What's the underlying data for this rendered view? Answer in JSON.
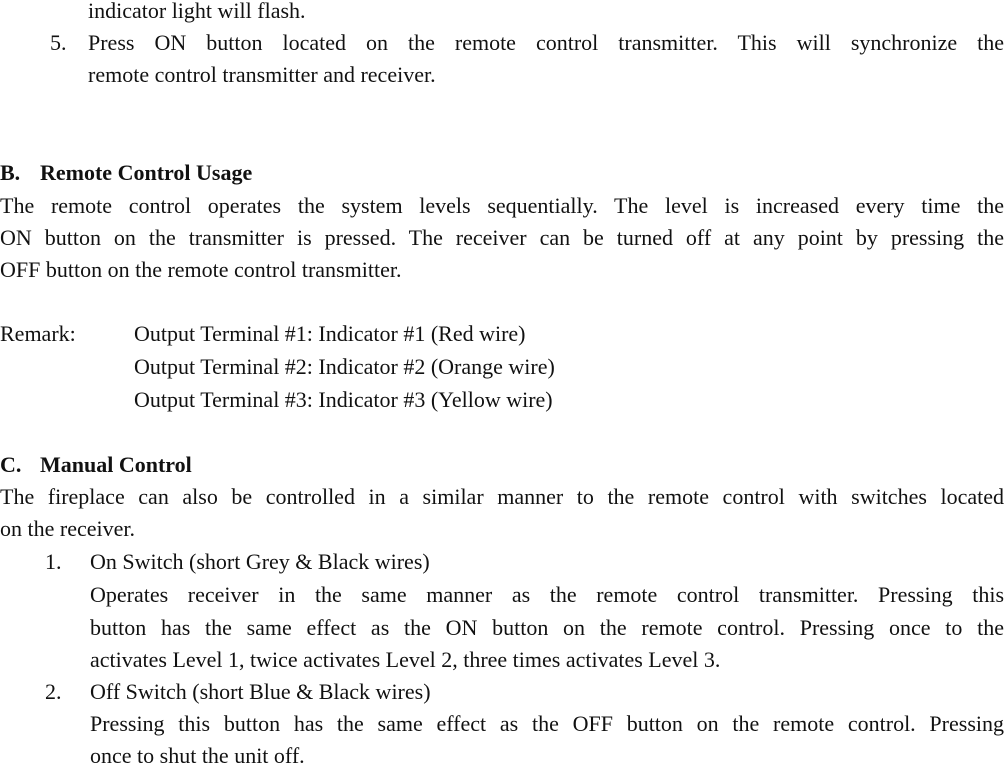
{
  "continuation": {
    "line1": "indicator light will flash."
  },
  "step5": {
    "number": "5.",
    "line1": "Press ON button located on the remote control transmitter. This will synchronize the",
    "line2": "remote control transmitter and receiver."
  },
  "section_b": {
    "letter": "B.",
    "title": "Remote Control Usage",
    "para_lines": [
      "The remote control operates the system levels sequentially. The level is increased every time the",
      "ON button on the transmitter is pressed. The receiver can be turned off at any point by pressing the",
      "OFF button on the remote control transmitter."
    ],
    "remark_label": "Remark:",
    "remarks": [
      "Output Terminal #1: Indicator #1 (Red wire)",
      "Output Terminal #2: Indicator #2 (Orange wire)",
      "Output Terminal #3: Indicator #3 (Yellow wire)"
    ]
  },
  "section_c": {
    "letter": "C.",
    "title": "Manual Control",
    "para_lines": [
      "The fireplace can also be controlled in a similar manner to the remote control with switches located",
      "on the receiver."
    ],
    "items": [
      {
        "number": "1.",
        "title": "On Switch (short Grey & Black wires)",
        "lines": [
          "Operates receiver in the same manner as the remote control transmitter. Pressing this",
          "button has the same effect as the ON button on the remote control. Pressing once to the",
          "activates Level 1, twice activates Level 2, three times activates Level 3."
        ]
      },
      {
        "number": "2.",
        "title": "Off Switch (short Blue & Black wires)",
        "lines": [
          "Pressing this button has the same effect as the OFF button on the remote control. Pressing",
          "once to shut the unit off."
        ]
      }
    ]
  }
}
